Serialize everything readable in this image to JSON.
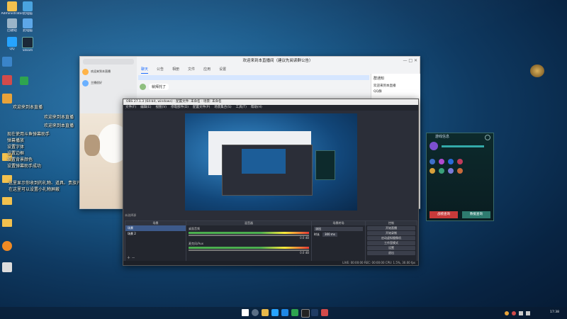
{
  "desktop": {
    "icons": [
      {
        "label": "Administrator",
        "color": "#f2c14e"
      },
      {
        "label": "此电脑",
        "color": "#4aa3df"
      },
      {
        "label": "回收站",
        "color": "#9ab4c8"
      },
      {
        "label": "此电脑",
        "color": "#5da7e8"
      },
      {
        "label": "Steam",
        "color": "#1b2838"
      },
      {
        "label": "QQ",
        "color": "#26a3ff"
      }
    ]
  },
  "overlay_chat": [
    {
      "name": "",
      "text": "欢迎来到本直播"
    },
    {
      "name": "",
      "text": "欢迎来到本直播"
    },
    {
      "name": "",
      "text": "欢迎来到本直播"
    }
  ],
  "overlay_lines": [
    "现在使用斗鱼弹幕助手",
    "弹幕播放",
    "设置字体",
    "设置边框",
    "设置背景颜色",
    "字体颜色",
    "设置弹幕助手成功"
  ],
  "overlay_lines2": [
    "这里显示你收到的礼物、道具、贵族开通",
    "在这里可以设置小礼物屏蔽"
  ],
  "qq": {
    "title": "欢迎来到本直播间（建议先阅读群公告）",
    "tabs": [
      "聊天",
      "公告",
      "相册",
      "文件",
      "应用",
      "设置"
    ],
    "active_tab": "聊天",
    "message": "就拜托了",
    "right_title": "群通知",
    "right_lines": [
      "欢迎来到本直播",
      "QQ群",
      "主播很好"
    ]
  },
  "obs": {
    "title": "OBS 27.1.3 (64-bit, windows) - 配置文件: 未命名 - 场景: 未命名",
    "menu": [
      "文件(F)",
      "编辑(E)",
      "视图(V)",
      "停靠部件(D)",
      "配置文件(P)",
      "场景集合(S)",
      "工具(T)",
      "帮助(H)"
    ],
    "panels": {
      "scenes": "场景",
      "sources": "来源",
      "mixer": "混音器",
      "transitions": "场景转场",
      "controls": "控制"
    },
    "scene_items": [
      "场景",
      "场景 2"
    ],
    "source_label": "未选择源",
    "mixer_tracks": [
      {
        "label": "桌面音频",
        "level": "0.0 dB"
      },
      {
        "label": "麦克风/Aux",
        "level": "0.0 dB"
      }
    ],
    "transition_label": "淡出",
    "duration_label": "时长",
    "duration_value": "300 ms",
    "controls": [
      "开始直播",
      "开始录制",
      "启动虚拟摄像机",
      "工作室模式",
      "设置",
      "退出"
    ],
    "status": "LIVE: 00:00:00   REC: 00:00:00   CPU: 1.5%, 30.00 fps"
  },
  "game_panel": {
    "title": "游戏信息",
    "btn1": "战绩查询",
    "btn2": "数据查询"
  },
  "taskbar": {
    "time": "17:38",
    "icons": [
      "windows",
      "search",
      "files",
      "qq",
      "edge",
      "wechat",
      "obs",
      "game",
      "app"
    ]
  },
  "colors": {
    "accent": "#1e6fff",
    "obs_bg": "#2b2e38",
    "game_btn1": "#c83a3a",
    "game_btn2": "#2e7b6f"
  }
}
